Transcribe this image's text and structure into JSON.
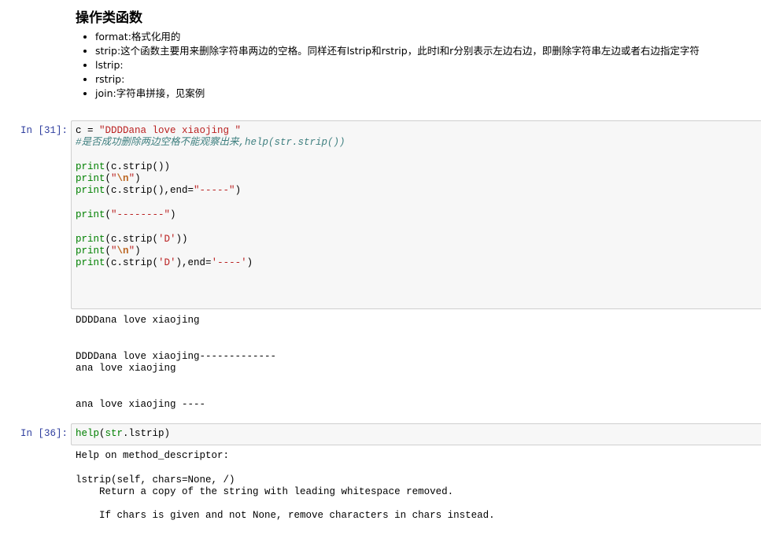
{
  "markdown": {
    "heading": "操作类函数",
    "items": [
      "format:格式化用的",
      "strip:这个函数主要用来删除字符串两边的空格。同样还有lstrip和rstrip，此时l和r分别表示左边右边，即删除字符串左边或者右边指定字符",
      "lstrip:",
      "rstrip:",
      "join:字符串拼接，见案例"
    ]
  },
  "cell1": {
    "prompt": "In [31]:",
    "code": {
      "l1_a": "c = ",
      "l1_str": "\"DDDDana love xiaojing \"",
      "l2_comment": "#是否成功删除两边空格不能观察出来,help(str.strip())",
      "l4_print": "print",
      "l4_rest": "(c.strip())",
      "l5_print": "print",
      "l5_open": "(",
      "l5_str_q1": "\"",
      "l5_escape": "\\n",
      "l5_str_q2": "\"",
      "l5_close": ")",
      "l6_print": "print",
      "l6_rest": "(c.strip(),end=",
      "l6_str": "\"-----\"",
      "l6_close": ")",
      "l8_print": "print",
      "l8_open": "(",
      "l8_str": "\"--------\"",
      "l8_close": ")",
      "l10_print": "print",
      "l10_rest": "(c.strip(",
      "l10_str": "'D'",
      "l10_close": "))",
      "l11_print": "print",
      "l11_open": "(",
      "l11_str_q1": "\"",
      "l11_escape": "\\n",
      "l11_str_q2": "\"",
      "l11_close": ")",
      "l12_print": "print",
      "l12_rest": "(c.strip(",
      "l12_str1": "'D'",
      "l12_mid": "),end=",
      "l12_str2": "'----'",
      "l12_close": ")"
    },
    "output": "DDDDana love xiaojing\n\n\nDDDDana love xiaojing-------------\nana love xiaojing\n\n\nana love xiaojing ----"
  },
  "cell2": {
    "prompt": "In [36]:",
    "code": {
      "help": "help",
      "open": "(",
      "str": "str",
      "rest": ".lstrip)"
    },
    "output": "Help on method_descriptor:\n\nlstrip(self, chars=None, /)\n    Return a copy of the string with leading whitespace removed.\n\n    If chars is given and not None, remove characters in chars instead."
  }
}
